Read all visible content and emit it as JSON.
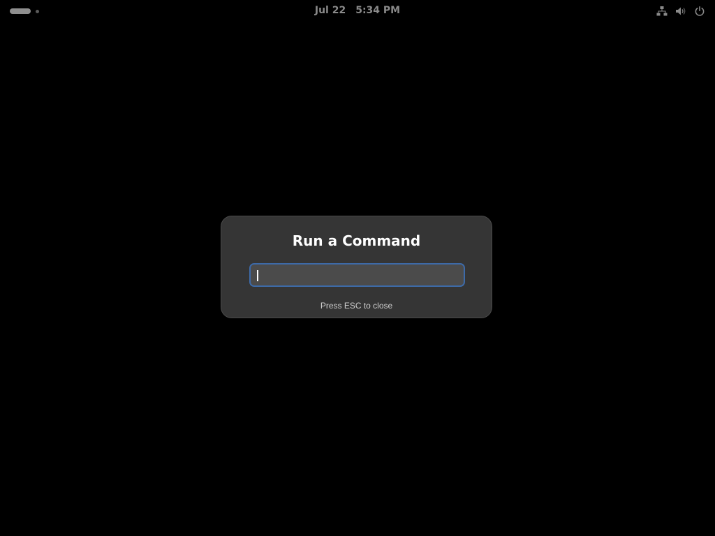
{
  "topbar": {
    "date": "Jul 22",
    "time": "5:34 PM",
    "tray_icons": [
      "network-icon",
      "volume-icon",
      "power-icon"
    ]
  },
  "dialog": {
    "title": "Run a Command",
    "input_value": "",
    "hint": "Press ESC to close"
  },
  "colors": {
    "background": "#000000",
    "dialog": "#353535",
    "focus_ring": "#3d6aa8",
    "topbar_text": "#8a8a8a"
  }
}
